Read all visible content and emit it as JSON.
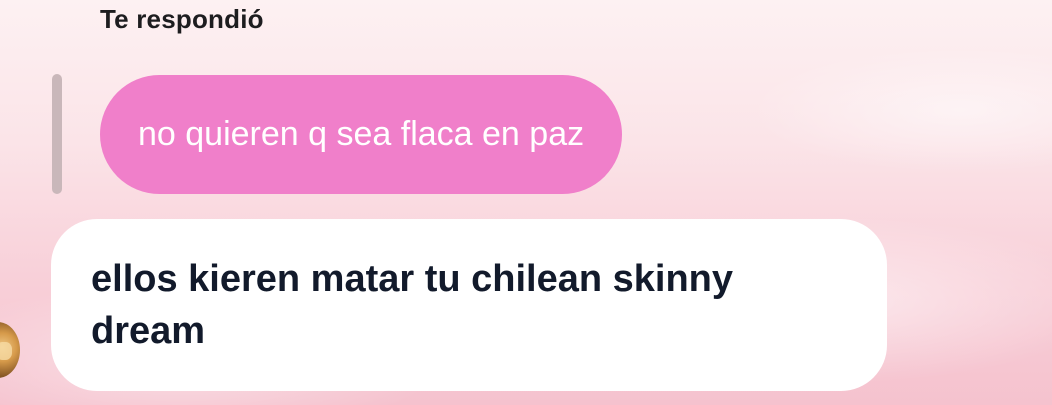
{
  "reply": {
    "label": "Te respondió",
    "quoted_message": "no quieren q sea flaca en paz"
  },
  "message": {
    "text": "ellos kieren matar tu chilean skinny dream"
  },
  "colors": {
    "quoted_bubble": "#f07fca",
    "message_bubble": "#ffffff",
    "reply_bar": "#c9b7ba"
  },
  "avatar": {
    "icon": "lion-avatar"
  }
}
